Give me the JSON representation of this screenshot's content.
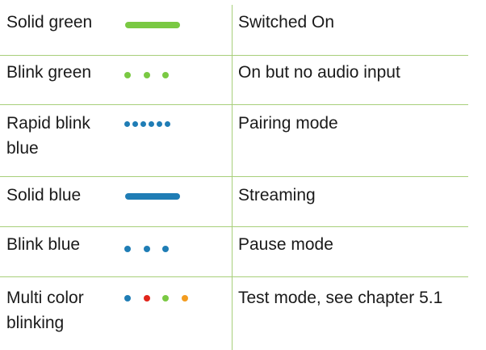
{
  "rows": [
    {
      "label": "Solid green",
      "description": "Switched On",
      "indicator": {
        "style": "solid",
        "colors": [
          "#7ac943"
        ]
      }
    },
    {
      "label": "Blink green",
      "description": "On but no audio input",
      "indicator": {
        "style": "blink",
        "colors": [
          "#7ac943",
          "#7ac943",
          "#7ac943"
        ]
      }
    },
    {
      "label": "Rapid blink blue",
      "description": "Pairing mode",
      "indicator": {
        "style": "rapid-blink",
        "colors": [
          "#1f7db5",
          "#1f7db5",
          "#1f7db5",
          "#1f7db5",
          "#1f7db5",
          "#1f7db5"
        ]
      }
    },
    {
      "label": "Solid blue",
      "description": "Streaming",
      "indicator": {
        "style": "solid",
        "colors": [
          "#1f7db5"
        ]
      }
    },
    {
      "label": "Blink blue",
      "description": "Pause mode",
      "indicator": {
        "style": "blink",
        "colors": [
          "#1f7db5",
          "#1f7db5",
          "#1f7db5"
        ]
      }
    },
    {
      "label": "Multi color blinking",
      "description": "Test mode, see chapter 5.1",
      "indicator": {
        "style": "blink",
        "colors": [
          "#1f7db5",
          "#e1251b",
          "#7ac943",
          "#f39c1f"
        ]
      }
    }
  ],
  "colors": {
    "divider": "#a8cf7a",
    "text": "#1a1a1a"
  }
}
